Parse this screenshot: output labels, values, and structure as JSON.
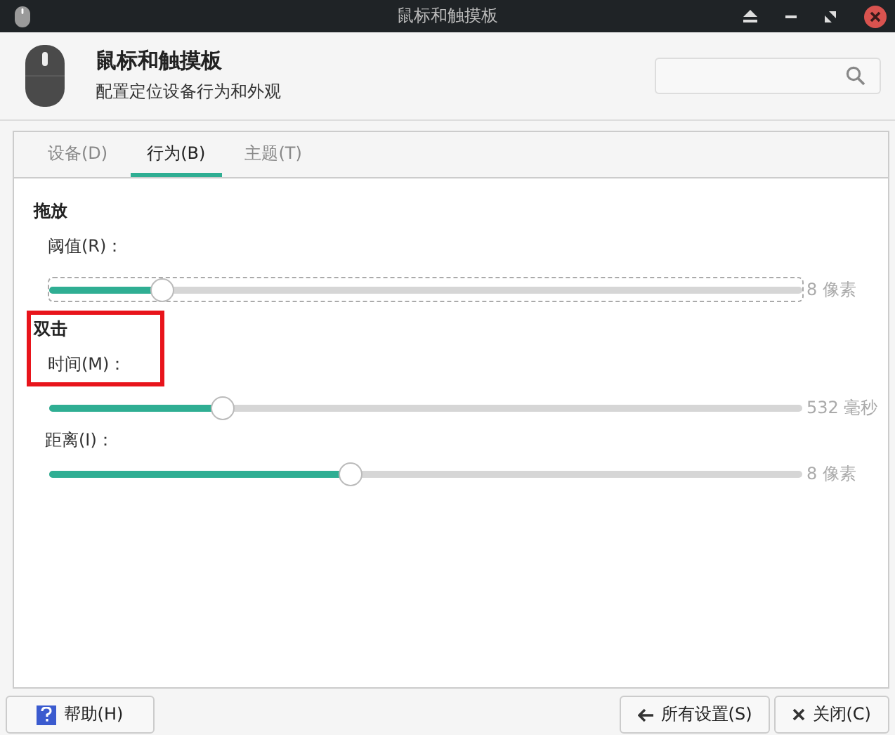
{
  "window": {
    "title": "鼠标和触摸板"
  },
  "header": {
    "title": "鼠标和触摸板",
    "subtitle": "配置定位设备行为和外观"
  },
  "tabs": [
    {
      "label": "设备(D)",
      "selected": false
    },
    {
      "label": "行为(B)",
      "selected": true
    },
    {
      "label": "主题(T)",
      "selected": false
    }
  ],
  "sections": [
    {
      "title": "拖放",
      "highlighted": false,
      "sliders": [
        {
          "label": "阈值(R)：",
          "level": 0.15,
          "reading": "8 像素",
          "focused": true
        }
      ]
    },
    {
      "title": "双击",
      "highlighted": true,
      "sliders": [
        {
          "label": "时间(M)：",
          "level": 0.23,
          "reading": "532 毫秒",
          "focused": false
        },
        {
          "label": "距离(I)：",
          "level": 0.4,
          "reading": "8 像素",
          "focused": false
        }
      ]
    }
  ],
  "buttons": {
    "help": "帮助(H)",
    "all_settings": "所有设置(S)",
    "close": "关闭(C)"
  }
}
